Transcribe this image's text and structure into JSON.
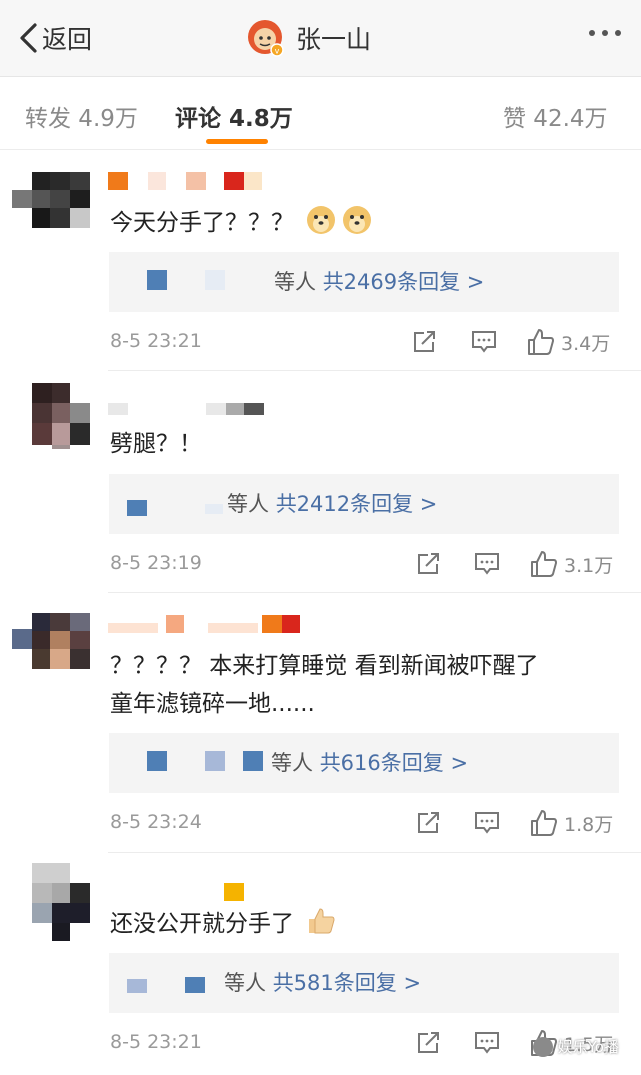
{
  "header": {
    "back_label": "返回",
    "title": "张一山"
  },
  "tabs": [
    {
      "label": "转发 4.9万"
    },
    {
      "label": "评论 4.8万"
    },
    {
      "label": "赞 42.4万"
    }
  ],
  "comments": [
    {
      "text": "今天分手了？？？",
      "reply_prefix": "等人",
      "reply_count": "共2469条回复 >",
      "time": "8-5 23:21",
      "likes": "3.4万"
    },
    {
      "text": "劈腿？！",
      "reply_prefix": "等人",
      "reply_count": "共2412条回复 >",
      "time": "8-5 23:19",
      "likes": "3.1万"
    },
    {
      "text_line1": "？？？？ 本来打算睡觉 看到新闻被吓醒了",
      "text_line2": "童年滤镜碎一地......",
      "reply_prefix": "等人",
      "reply_count": "共616条回复 >",
      "time": "8-5 23:24",
      "likes": "1.8万"
    },
    {
      "text": "还没公开就分手了",
      "reply_prefix": "等人",
      "reply_count": "共581条回复 >",
      "time": "8-5 23:21",
      "likes": "1.5万"
    }
  ],
  "watermark": "娱乐Yo播",
  "colors": {
    "accent": "#ff8200",
    "link": "#4a6fa5"
  },
  "icons": [
    "chevron-left-icon",
    "verified-badge-icon",
    "more-icon",
    "share-icon",
    "comment-icon",
    "like-icon",
    "doge-emoji-icon",
    "thumbs-up-emoji-icon"
  ]
}
